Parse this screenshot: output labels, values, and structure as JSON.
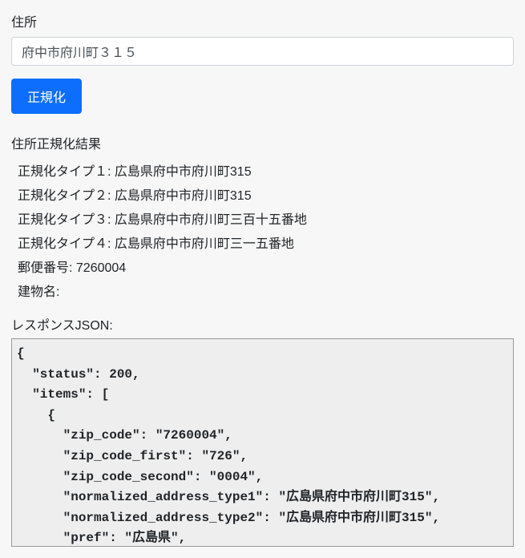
{
  "form": {
    "address_label": "住所",
    "address_value": "府中市府川町３１５",
    "normalize_button": "正規化"
  },
  "results": {
    "title": "住所正規化結果",
    "items": [
      {
        "label": "正規化タイプ１: ",
        "value": "広島県府中市府川町315"
      },
      {
        "label": "正規化タイプ２: ",
        "value": "広島県府中市府川町315"
      },
      {
        "label": "正規化タイプ３: ",
        "value": "広島県府中市府川町三百十五番地"
      },
      {
        "label": "正規化タイプ４: ",
        "value": "広島県府中市府川町三一五番地"
      },
      {
        "label": "郵便番号: ",
        "value": "7260004"
      },
      {
        "label": "建物名: ",
        "value": ""
      }
    ]
  },
  "json_section": {
    "label": "レスポンスJSON:",
    "content": "{\n  \"status\": 200,\n  \"items\": [\n    {\n      \"zip_code\": \"7260004\",\n      \"zip_code_first\": \"726\",\n      \"zip_code_second\": \"0004\",\n      \"normalized_address_type1\": \"広島県府中市府川町315\",\n      \"normalized_address_type2\": \"広島県府中市府川町315\",\n      \"pref\": \"広島県\",\n      \"city\": \"府中市\""
  }
}
